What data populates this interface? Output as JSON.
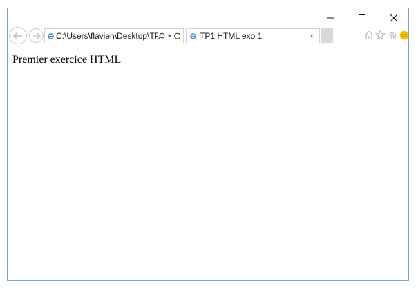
{
  "window": {
    "controls": {
      "minimize_icon": "minimize-icon",
      "maximize_icon": "maximize-icon",
      "close_icon": "close-icon"
    }
  },
  "navbar": {
    "back_icon": "back-arrow-icon",
    "forward_icon": "forward-arrow-icon",
    "address": {
      "value": "C:\\Users\\flavien\\Desktop\\TP",
      "favicon": "ie-page-icon",
      "search_icon": "search-icon",
      "dropdown_icon": "chevron-down-icon",
      "refresh_icon": "refresh-icon"
    },
    "tab": {
      "title": "TP1 HTML exo 1",
      "close_glyph": "×",
      "favicon": "ie-page-icon"
    },
    "tools": [
      "home-icon",
      "star-icon",
      "gear-icon",
      "smiley-icon"
    ]
  },
  "page": {
    "heading": "Premier exercice HTML"
  },
  "colors": {
    "window_border": "#7aa6c8",
    "newtab_bg": "#d8d8d8",
    "favicon_blue": "#3b8ed8",
    "smiley": "#f2c200"
  }
}
